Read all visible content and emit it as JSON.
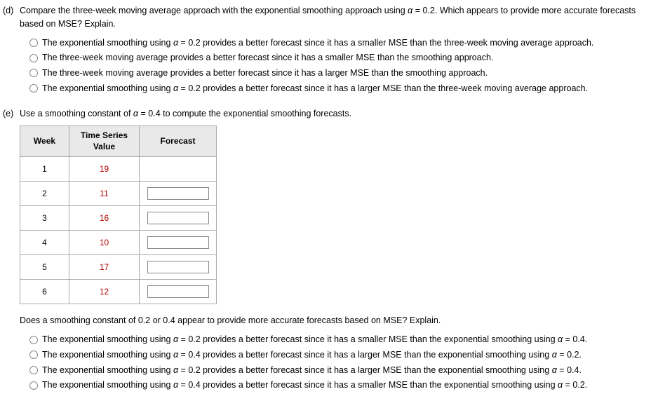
{
  "partD": {
    "label": "(d)",
    "prompt_pre": "Compare the three-week moving average approach with the exponential smoothing approach using ",
    "prompt_alpha": "α",
    "prompt_post": " = 0.2. Which appears to provide more accurate forecasts based on MSE? Explain.",
    "options": [
      {
        "preA": "The exponential smoothing using ",
        "alpha": "α",
        "postA": " = 0.2 provides a better forecast since it has a smaller MSE than the three-week moving average approach."
      },
      {
        "text": "The three-week moving average provides a better forecast since it has a smaller MSE than the smoothing approach."
      },
      {
        "text": "The three-week moving average provides a better forecast since it has a larger MSE than the smoothing approach."
      },
      {
        "preA": "The exponential smoothing using ",
        "alpha": "α",
        "postA": " = 0.2 provides a better forecast since it has a larger MSE than the three-week moving average approach."
      }
    ]
  },
  "partE": {
    "label": "(e)",
    "prompt_pre": "Use a smoothing constant of ",
    "prompt_alpha": "α",
    "prompt_post": " = 0.4 to compute the exponential smoothing forecasts.",
    "table": {
      "headers": {
        "week": "Week",
        "value_l1": "Time Series",
        "value_l2": "Value",
        "forecast": "Forecast"
      },
      "rows": [
        {
          "week": "1",
          "value": "19",
          "has_input": false
        },
        {
          "week": "2",
          "value": "11",
          "has_input": true
        },
        {
          "week": "3",
          "value": "16",
          "has_input": true
        },
        {
          "week": "4",
          "value": "10",
          "has_input": true
        },
        {
          "week": "5",
          "value": "17",
          "has_input": true
        },
        {
          "week": "6",
          "value": "12",
          "has_input": true
        }
      ]
    },
    "subprompt": "Does a smoothing constant of 0.2 or 0.4 appear to provide more accurate forecasts based on MSE? Explain.",
    "options": [
      {
        "preA": "The exponential smoothing using ",
        "alphaA": "α",
        "midA": " = 0.2 provides a better forecast since it has a smaller MSE than the exponential smoothing using ",
        "alphaB": "α",
        "postB": " = 0.4."
      },
      {
        "preA": "The exponential smoothing using ",
        "alphaA": "α",
        "midA": " = 0.4 provides a better forecast since it has a larger MSE than the exponential smoothing using ",
        "alphaB": "α",
        "postB": " = 0.2."
      },
      {
        "preA": "The exponential smoothing using ",
        "alphaA": "α",
        "midA": " = 0.2 provides a better forecast since it has a larger MSE than the exponential smoothing using ",
        "alphaB": "α",
        "postB": " = 0.4."
      },
      {
        "preA": "The exponential smoothing using ",
        "alphaA": "α",
        "midA": " = 0.4 provides a better forecast since it has a smaller MSE than the exponential smoothing using ",
        "alphaB": "α",
        "postB": " = 0.2."
      }
    ]
  }
}
